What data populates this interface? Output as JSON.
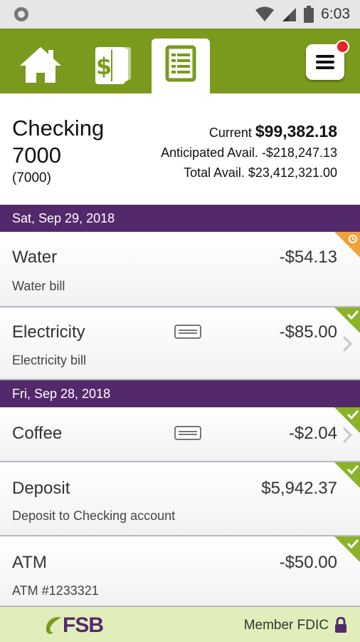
{
  "status_bar": {
    "time": "6:03"
  },
  "nav": {
    "tabs": [
      {
        "id": "home",
        "icon": "home-icon"
      },
      {
        "id": "transfer",
        "icon": "dollar-cards-icon"
      },
      {
        "id": "transactions",
        "icon": "list-document-icon",
        "active": true
      }
    ],
    "menu_icon": "hamburger-menu-icon",
    "notification_badge": true
  },
  "account": {
    "name": "Checking 7000",
    "number": "(7000)",
    "current_label": "Current",
    "current_value": "$99,382.18",
    "anticipated": "Anticipated Avail. -$218,247.13",
    "total": "Total Avail. $23,412,321.00"
  },
  "groups": [
    {
      "date": "Sat, Sep 29, 2018",
      "transactions": [
        {
          "name": "Water",
          "description": "Water bill",
          "amount": "-$54.13",
          "status": "pending",
          "has_card": false,
          "has_chevron": false
        },
        {
          "name": "Electricity",
          "description": "Electricity bill",
          "amount": "-$85.00",
          "status": "cleared",
          "has_card": true,
          "has_chevron": true
        }
      ]
    },
    {
      "date": "Fri, Sep 28, 2018",
      "transactions": [
        {
          "name": "Coffee",
          "description": "",
          "amount": "-$2.04",
          "status": "cleared",
          "has_card": true,
          "has_chevron": true
        },
        {
          "name": "Deposit",
          "description": "Deposit to Checking account",
          "amount": "$5,942.37",
          "status": "cleared",
          "has_card": false,
          "has_chevron": false
        },
        {
          "name": "ATM",
          "description": "ATM #1233321",
          "amount": "-$50.00",
          "status": "cleared",
          "has_card": false,
          "has_chevron": false
        }
      ]
    }
  ],
  "footer": {
    "logo": "FSB",
    "member": "Member FDIC"
  },
  "colors": {
    "brand_green": "#7a9a1d",
    "date_header": "#53296b",
    "cleared": "#8ab32a",
    "pending": "#f0a23a",
    "footer_bg": "#e1eebb"
  }
}
